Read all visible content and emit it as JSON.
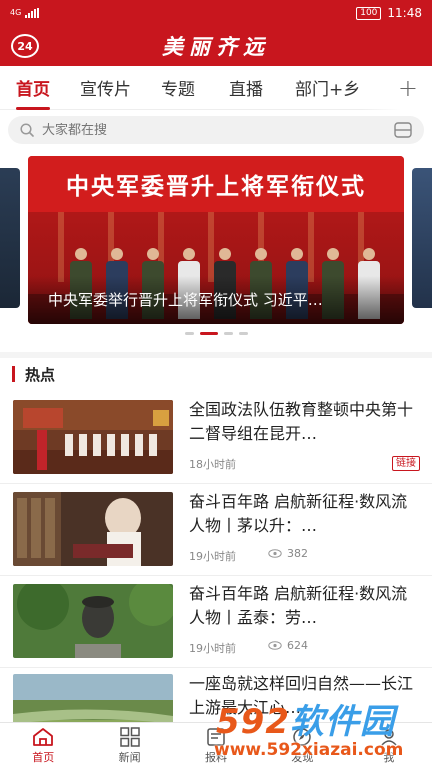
{
  "status_bar": {
    "network": "4G",
    "time": "11:48",
    "battery": "100"
  },
  "header": {
    "badge": "24",
    "title": "美丽齐远"
  },
  "tabs": [
    {
      "label": "首页",
      "active": true
    },
    {
      "label": "宣传片",
      "active": false
    },
    {
      "label": "专题",
      "active": false
    },
    {
      "label": "直播",
      "active": false
    },
    {
      "label": "部门+乡",
      "active": false
    }
  ],
  "search": {
    "placeholder": "大家都在搜"
  },
  "carousel": {
    "headline": "中央军委晋升上将军衔仪式",
    "caption": "中央军委举行晋升上将军衔仪式 习近平…",
    "slide_count": 4,
    "active_index": 1
  },
  "section": {
    "title": "热点"
  },
  "news": [
    {
      "title": "全国政法队伍教育整顿中央第十二督导组在昆开…",
      "time": "18小时前",
      "views": "",
      "tag": "链接"
    },
    {
      "title": "奋斗百年路 启航新征程·数风流人物丨茅以升：…",
      "time": "19小时前",
      "views": "382",
      "tag": ""
    },
    {
      "title": "奋斗百年路 启航新征程·数风流人物丨孟泰：劳…",
      "time": "19小时前",
      "views": "624",
      "tag": ""
    },
    {
      "title": "一座岛就这样回归自然——长江上游最大江心…",
      "time": "",
      "views": "",
      "tag": ""
    }
  ],
  "bottom_nav": [
    {
      "label": "首页",
      "icon": "home-icon",
      "active": true
    },
    {
      "label": "新闻",
      "icon": "grid-icon",
      "active": false
    },
    {
      "label": "报料",
      "icon": "report-icon",
      "active": false
    },
    {
      "label": "发现",
      "icon": "discover-icon",
      "active": false
    },
    {
      "label": "我",
      "icon": "user-icon",
      "active": false
    }
  ],
  "watermark": {
    "logo_num": "592",
    "logo_text": "软件园",
    "url": "www.592xiazai.com"
  },
  "colors": {
    "brand_red": "#c8161e",
    "watermark_blue": "#3a9ee8",
    "watermark_orange": "#e8581a"
  }
}
